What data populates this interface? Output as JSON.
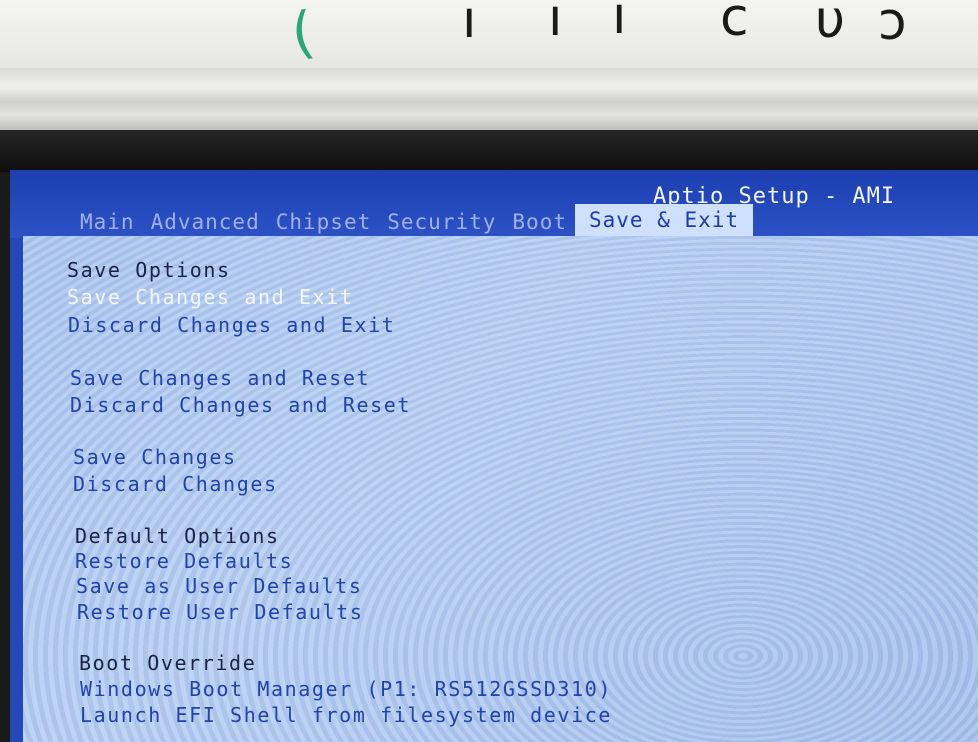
{
  "app": {
    "title": "Aptio Setup - AMI"
  },
  "tabs": [
    {
      "label": "Main",
      "active": false
    },
    {
      "label": "Advanced",
      "active": false
    },
    {
      "label": "Chipset",
      "active": false
    },
    {
      "label": "Security",
      "active": false
    },
    {
      "label": "Boot",
      "active": false
    },
    {
      "label": "Save & Exit",
      "active": true
    }
  ],
  "sections": {
    "save_options": {
      "heading": "Save Options",
      "items": [
        "Save Changes and Exit",
        "Discard Changes and Exit"
      ]
    },
    "reset_options": {
      "items": [
        "Save Changes and Reset",
        "Discard Changes and Reset"
      ]
    },
    "change_options": {
      "items": [
        "Save Changes",
        "Discard Changes"
      ]
    },
    "default_options": {
      "heading": "Default Options",
      "items": [
        "Restore Defaults",
        "Save as User Defaults",
        "Restore User Defaults"
      ]
    },
    "boot_override": {
      "heading": "Boot Override",
      "items": [
        "Windows Boot Manager (P1: RS512GSSD310)",
        "Launch EFI Shell from filesystem device"
      ]
    }
  },
  "selected_item": "Save Changes and Exit",
  "colors": {
    "bios_blue": "#2448b8",
    "panel_light_blue": "#b2cbf3",
    "item_text": "#2243a8",
    "heading_text": "#1a2347",
    "active_tab_bg": "#cfe0ff",
    "highlight_text": "#f4f6ff"
  }
}
